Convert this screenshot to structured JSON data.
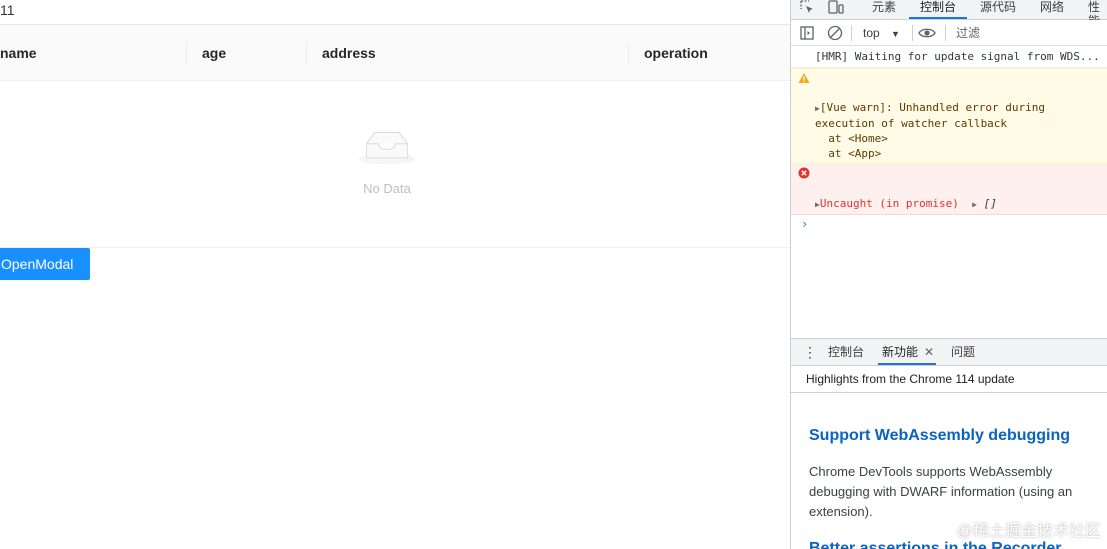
{
  "app": {
    "counter": "11",
    "table": {
      "columns": [
        "name",
        "age",
        "address",
        "operation"
      ],
      "empty_text": "No Data"
    },
    "open_modal_label": "OpenModal"
  },
  "devtools": {
    "tabs": [
      "元素",
      "控制台",
      "源代码",
      "网络",
      "性能"
    ],
    "active_tab": "控制台",
    "toolbar": {
      "context": "top",
      "filter_placeholder": "过滤"
    },
    "console": {
      "info": "[HMR] Waiting for update signal from WDS...",
      "warn_line1": "[Vue warn]: Unhandled error during",
      "warn_line2": "execution of watcher callback",
      "warn_line3": "  at <Home>",
      "warn_line4": "  at <App>",
      "error_text": "Uncaught (in promise)",
      "error_value": "[]",
      "prompt": "›"
    },
    "drawer": {
      "tabs": [
        "控制台",
        "新功能",
        "问题"
      ],
      "active_tab": "新功能",
      "subtitle": "Highlights from the Chrome 114 update",
      "feature1_title": "Support WebAssembly debugging",
      "feature1_desc": "Chrome DevTools supports WebAssembly debugging with DWARF information (using an extension).",
      "feature2_title": "Better assertions in the Recorder"
    },
    "colors": {
      "accent": "#1a73e8",
      "primary_button": "#1890ff",
      "warn_bg": "#fffbe6",
      "error_bg": "#fff0f0"
    }
  },
  "watermark": "@稀土掘金技术社区"
}
